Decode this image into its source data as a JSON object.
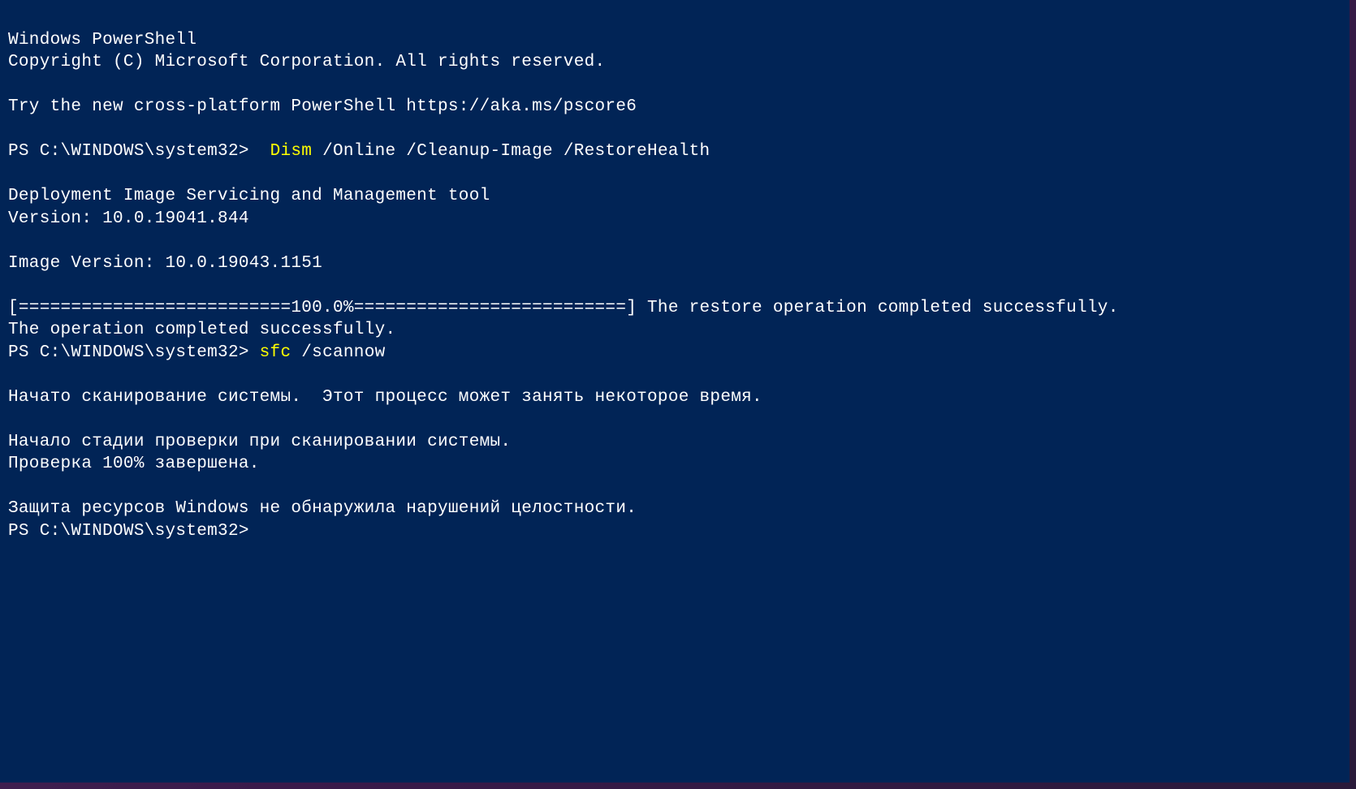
{
  "terminal": {
    "header_line1": "Windows PowerShell",
    "header_line2": "Copyright (C) Microsoft Corporation. All rights reserved.",
    "try_line": "Try the new cross-platform PowerShell https://aka.ms/pscore6",
    "prompt1_prefix": "PS C:\\WINDOWS\\system32>  ",
    "prompt1_cmd": "Dism",
    "prompt1_args": " /Online /Cleanup-Image /RestoreHealth",
    "dism_tool_line": "Deployment Image Servicing and Management tool",
    "dism_version": "Version: 10.0.19041.844",
    "image_version": "Image Version: 10.0.19043.1151",
    "progress_line": "[==========================100.0%==========================] The restore operation completed successfully.",
    "operation_success": "The operation completed successfully.",
    "prompt2_prefix": "PS C:\\WINDOWS\\system32> ",
    "prompt2_cmd": "sfc",
    "prompt2_args": " /scannow",
    "scan_started": "Начато сканирование системы.  Этот процесс может занять некоторое время.",
    "scan_stage": "Начало стадии проверки при сканировании системы.",
    "scan_percent": "Проверка 100% завершена.",
    "scan_result": "Защита ресурсов Windows не обнаружила нарушений целостности.",
    "prompt3": "PS C:\\WINDOWS\\system32>"
  }
}
